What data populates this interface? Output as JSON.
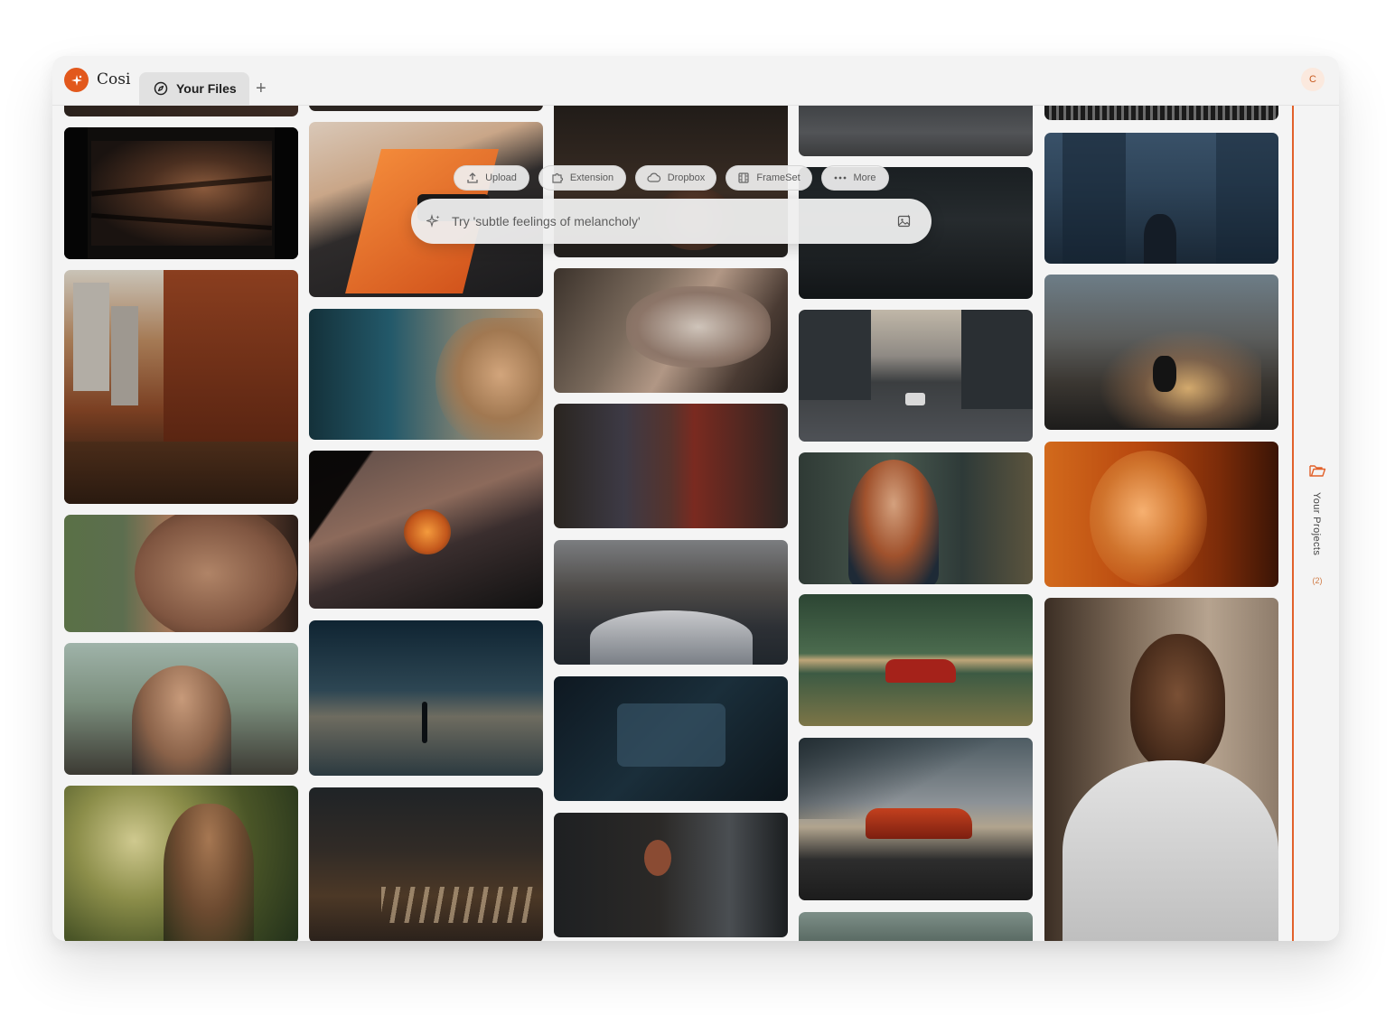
{
  "app": {
    "brand": "Cosi"
  },
  "tabs": [
    {
      "label": "Your Files",
      "icon": "compass-icon"
    }
  ],
  "new_tab": "+",
  "user": {
    "initial": "C"
  },
  "toolbar": {
    "buttons": [
      {
        "label": "Upload",
        "icon": "upload-icon"
      },
      {
        "label": "Extension",
        "icon": "puzzle-icon"
      },
      {
        "label": "Dropbox",
        "icon": "cloud-icon"
      },
      {
        "label": "FrameSet",
        "icon": "film-icon"
      },
      {
        "label": "More",
        "icon": "more-icon"
      }
    ]
  },
  "search": {
    "placeholder": "Try 'subtle feelings of melancholy'",
    "icon": "sparkle-icon",
    "image_search_icon": "image-search-icon"
  },
  "sidebar": {
    "label": "Your Projects",
    "count": "(2)",
    "icon": "folder-icon"
  },
  "colors": {
    "accent": "#e2581c",
    "window_bg": "#f4f4f4"
  },
  "gallery": {
    "columns": [
      {
        "tiles": [
          "city-window-blinds-portrait",
          "orange-brick-street-morning",
          "woman-profile-closeup",
          "woman-arms-raised-street",
          "woman-sun-sparkles-portrait"
        ]
      },
      {
        "tiles": [
          "car-rearview-mirror-sunset",
          "woman-hair-blowing-teal",
          "car-window-side-mirror-dusk",
          "person-on-beach-twilight",
          "crosswalk-evening-street"
        ]
      },
      {
        "tiles": [
          "dark-blurred-scene",
          "motion-blur-car-woman",
          "motion-blur-street-people",
          "car-hood-city-street",
          "car-interior-dark-dashboard",
          "woman-driving-car-interior"
        ]
      },
      {
        "tiles": [
          "city-street-aerial-top",
          "dark-road-dusk",
          "city-street-skyline-road",
          "redhead-woman-portrait",
          "red-car-motion-green",
          "red-car-bridge-sunset",
          "bridge-partial-bottom"
        ]
      },
      {
        "tiles": [
          "building-facade-top",
          "foggy-skyscrapers-woman",
          "cyclist-misty-street",
          "woman-orange-light-portrait",
          "man-white-tshirt-portrait"
        ]
      }
    ]
  }
}
